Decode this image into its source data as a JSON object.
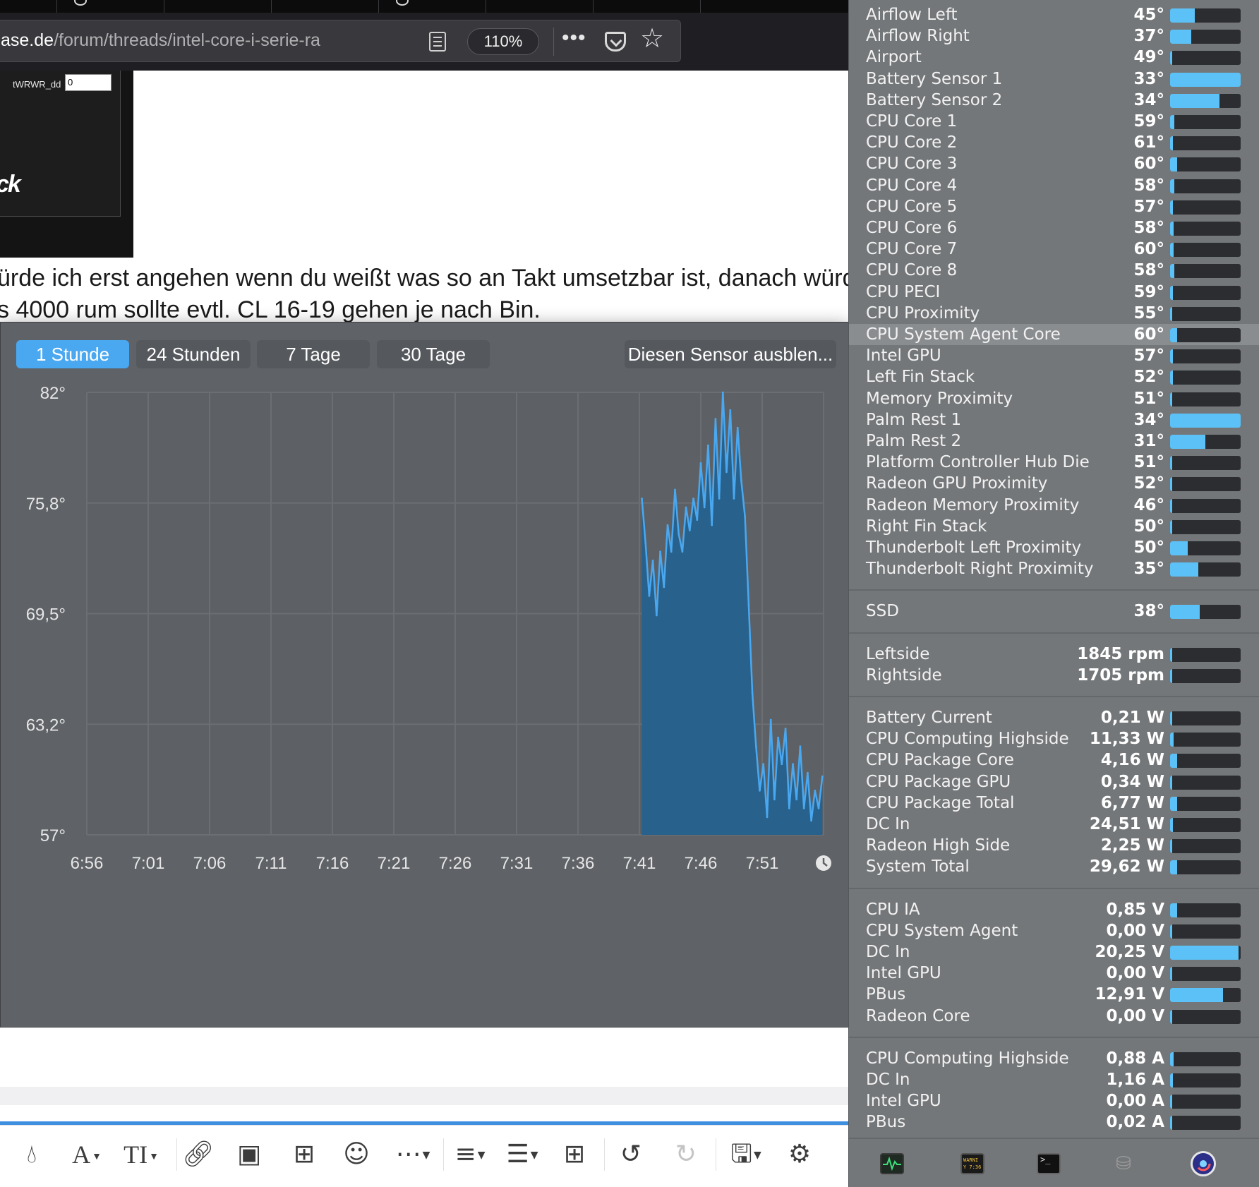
{
  "browser": {
    "url_host": "ase.de",
    "url_path": "/forum/threads/intel-core-i-serie-ra",
    "zoom": "110%"
  },
  "post": {
    "twrwr_label": "tWRWR_dd",
    "twrwr_value": "0",
    "logo_fragment": "ck",
    "line1": "ürde ich erst angehen wenn du weißt was so an Takt umsetzbar ist, danach würde",
    "line2": "s 4000 rum sollte evtl. CL 16-19 gehen je nach Bin."
  },
  "chart_popup": {
    "ranges": [
      "1 Stunde",
      "24 Stunden",
      "7 Tage",
      "30 Tage"
    ],
    "active_range": "1 Stunde",
    "hide_sensor": "Diesen Sensor ausblen..."
  },
  "chart_data": {
    "type": "area",
    "ylim": [
      57,
      82
    ],
    "y_ticks": [
      "82°",
      "75,8°",
      "69,5°",
      "63,2°",
      "57°"
    ],
    "x_ticks": [
      "6:56",
      "7:01",
      "7:06",
      "7:11",
      "7:16",
      "7:21",
      "7:26",
      "7:31",
      "7:36",
      "7:41",
      "7:46",
      "7:51"
    ],
    "x_range_minutes": [
      0,
      60
    ],
    "colors": {
      "line": "#4aa8f0",
      "fill": "#27618c"
    },
    "series": [
      {
        "x": [
          45.2,
          45.5,
          45.8,
          46.1,
          46.4,
          46.7,
          47.0,
          47.3,
          47.6,
          47.9,
          48.2,
          48.5,
          48.8,
          49.1,
          49.4,
          49.7,
          50.0,
          50.3,
          50.6,
          50.9,
          51.2,
          51.5,
          51.8,
          52.1,
          52.4,
          52.7,
          53.0,
          53.3,
          53.6,
          53.9,
          54.2,
          54.5,
          54.8,
          55.1,
          55.4,
          55.7,
          56.0,
          56.3,
          56.6,
          56.9,
          57.2,
          57.5,
          57.8,
          58.1,
          58.4,
          58.7,
          59.0,
          59.3,
          59.6,
          59.9
        ],
        "y": [
          76.0,
          73.5,
          70.5,
          72.5,
          69.4,
          73.0,
          71.0,
          74.5,
          73.0,
          76.5,
          74.0,
          73.0,
          75.5,
          74.2,
          76.0,
          74.8,
          78.0,
          75.5,
          79.0,
          74.5,
          80.5,
          76.0,
          82.0,
          77.5,
          81.0,
          76.0,
          80.0,
          77.0,
          75.0,
          70.0,
          65.0,
          62.0,
          59.5,
          61.0,
          58.0,
          63.5,
          59.0,
          62.5,
          61.0,
          63.0,
          58.5,
          61.0,
          59.0,
          62.0,
          58.5,
          60.5,
          57.8,
          59.5,
          58.5,
          60.3
        ]
      }
    ]
  },
  "sensors": {
    "temperatures": [
      {
        "name": "Airflow Left",
        "value": "45°",
        "fill": 0.35
      },
      {
        "name": "Airflow Right",
        "value": "37°",
        "fill": 0.3
      },
      {
        "name": "Airport",
        "value": "49°",
        "fill": 0.02
      },
      {
        "name": "Battery Sensor 1",
        "value": "33°",
        "fill": 1.0
      },
      {
        "name": "Battery Sensor 2",
        "value": "34°",
        "fill": 0.7
      },
      {
        "name": "CPU Core 1",
        "value": "59°",
        "fill": 0.06
      },
      {
        "name": "CPU Core 2",
        "value": "61°",
        "fill": 0.04
      },
      {
        "name": "CPU Core 3",
        "value": "60°",
        "fill": 0.1
      },
      {
        "name": "CPU Core 4",
        "value": "58°",
        "fill": 0.06
      },
      {
        "name": "CPU Core 5",
        "value": "57°",
        "fill": 0.04
      },
      {
        "name": "CPU Core 6",
        "value": "58°",
        "fill": 0.05
      },
      {
        "name": "CPU Core 7",
        "value": "60°",
        "fill": 0.05
      },
      {
        "name": "CPU Core 8",
        "value": "58°",
        "fill": 0.06
      },
      {
        "name": "CPU PECI",
        "value": "59°",
        "fill": 0.04
      },
      {
        "name": "CPU Proximity",
        "value": "55°",
        "fill": 0.03
      },
      {
        "name": "CPU System Agent Core",
        "value": "60°",
        "fill": 0.1,
        "highlighted": true
      },
      {
        "name": "Intel GPU",
        "value": "57°",
        "fill": 0.04
      },
      {
        "name": "Left Fin Stack",
        "value": "52°",
        "fill": 0.04
      },
      {
        "name": "Memory Proximity",
        "value": "51°",
        "fill": 0.02
      },
      {
        "name": "Palm Rest 1",
        "value": "34°",
        "fill": 1.0
      },
      {
        "name": "Palm Rest 2",
        "value": "31°",
        "fill": 0.5
      },
      {
        "name": "Platform Controller Hub Die",
        "value": "51°",
        "fill": 0.02
      },
      {
        "name": "Radeon GPU Proximity",
        "value": "52°",
        "fill": 0.03
      },
      {
        "name": "Radeon Memory Proximity",
        "value": "46°",
        "fill": 0.02
      },
      {
        "name": "Right Fin Stack",
        "value": "50°",
        "fill": 0.02
      },
      {
        "name": "Thunderbolt Left Proximity",
        "value": "50°",
        "fill": 0.25
      },
      {
        "name": "Thunderbolt Right Proximity",
        "value": "35°",
        "fill": 0.4
      }
    ],
    "drives": [
      {
        "name": "SSD",
        "value": "38°",
        "fill": 0.42
      }
    ],
    "fans": [
      {
        "name": "Leftside",
        "value": "1845 rpm",
        "fill": 0.02
      },
      {
        "name": "Rightside",
        "value": "1705 rpm",
        "fill": 0.02
      }
    ],
    "power": [
      {
        "name": "Battery Current",
        "value": "0,21 W",
        "fill": 0.02
      },
      {
        "name": "CPU Computing Highside",
        "value": "11,33 W",
        "fill": 0.05
      },
      {
        "name": "CPU Package Core",
        "value": "4,16 W",
        "fill": 0.1
      },
      {
        "name": "CPU Package GPU",
        "value": "0,34 W",
        "fill": 0.02
      },
      {
        "name": "CPU Package Total",
        "value": "6,77 W",
        "fill": 0.1
      },
      {
        "name": "DC In",
        "value": "24,51 W",
        "fill": 0.04
      },
      {
        "name": "Radeon High Side",
        "value": "2,25 W",
        "fill": 0.03
      },
      {
        "name": "System Total",
        "value": "29,62 W",
        "fill": 0.1
      }
    ],
    "voltages": [
      {
        "name": "CPU IA",
        "value": "0,85 V",
        "fill": 0.1
      },
      {
        "name": "CPU System Agent",
        "value": "0,00 V",
        "fill": 0.02
      },
      {
        "name": "DC In",
        "value": "20,25 V",
        "fill": 0.97
      },
      {
        "name": "Intel GPU",
        "value": "0,00 V",
        "fill": 0.02
      },
      {
        "name": "PBus",
        "value": "12,91 V",
        "fill": 0.75
      },
      {
        "name": "Radeon Core",
        "value": "0,00 V",
        "fill": 0.02
      }
    ],
    "currents": [
      {
        "name": "CPU Computing Highside",
        "value": "0,88 A",
        "fill": 0.05
      },
      {
        "name": "DC In",
        "value": "1,16 A",
        "fill": 0.04
      },
      {
        "name": "Intel GPU",
        "value": "0,00 A",
        "fill": 0.02
      },
      {
        "name": "PBus",
        "value": "0,02 A",
        "fill": 0.03
      }
    ]
  },
  "dock": {
    "warn_label": "WARNI",
    "warn_time": "Y 7:36"
  }
}
